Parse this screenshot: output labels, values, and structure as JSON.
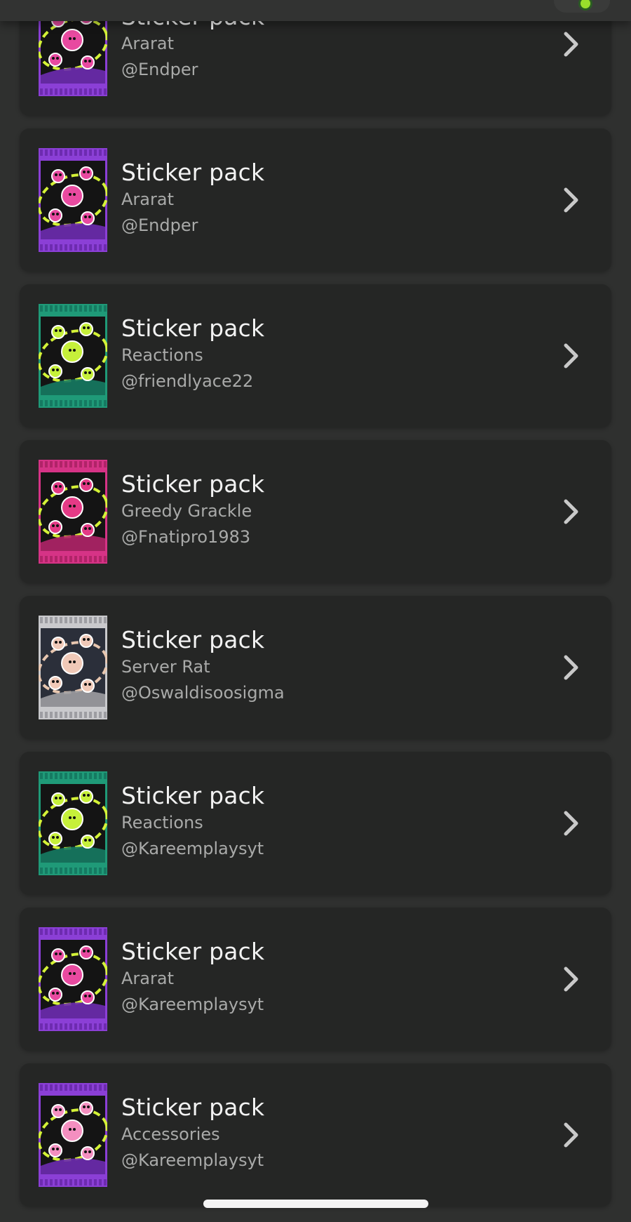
{
  "items": [
    {
      "title": "Sticker pack",
      "name": "Ararat",
      "author": "@Endper",
      "theme": "purple-bats"
    },
    {
      "title": "Sticker pack",
      "name": "Ararat",
      "author": "@Endper",
      "theme": "purple-bats"
    },
    {
      "title": "Sticker pack",
      "name": "Reactions",
      "author": "@friendlyace22",
      "theme": "teal-reactions"
    },
    {
      "title": "Sticker pack",
      "name": "Greedy Grackle",
      "author": "@Fnatipro1983",
      "theme": "pink-grackle"
    },
    {
      "title": "Sticker pack",
      "name": "Server Rat",
      "author": "@Oswaldisoosigma",
      "theme": "silver-rat"
    },
    {
      "title": "Sticker pack",
      "name": "Reactions",
      "author": "@Kareemplaysyt",
      "theme": "teal-reactions"
    },
    {
      "title": "Sticker pack",
      "name": "Ararat",
      "author": "@Kareemplaysyt",
      "theme": "purple-bats"
    },
    {
      "title": "Sticker pack",
      "name": "Accessories",
      "author": "@Kareemplaysyt",
      "theme": "purple-accessories"
    }
  ],
  "colors": {
    "background": "#2f302f",
    "card": "#252625",
    "title_text": "#f2f2f2",
    "secondary_text": "#a9aaa9",
    "chevron": "#c9c9c9"
  },
  "icons": {
    "chevron": "chevron-right-icon",
    "pack": "sticker-pack-icon"
  }
}
